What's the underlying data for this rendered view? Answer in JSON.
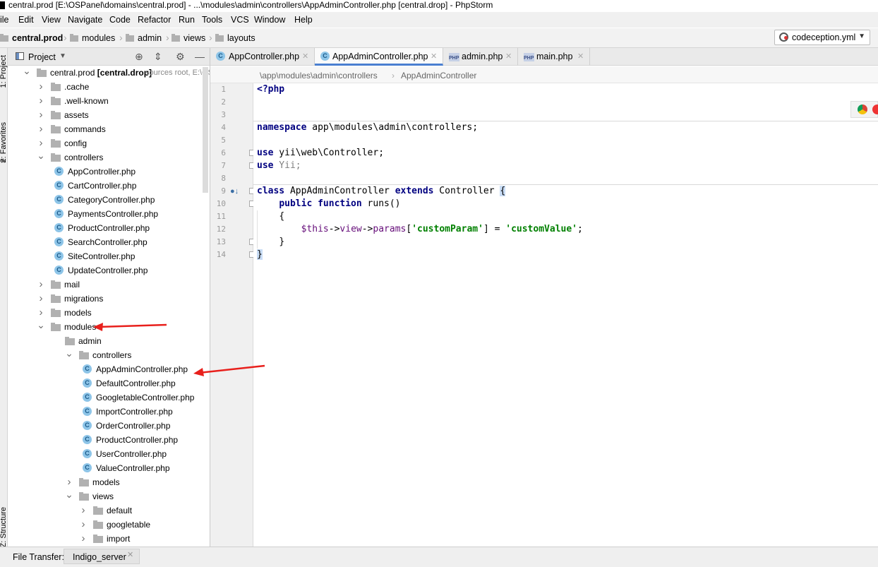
{
  "window": {
    "title": "central.prod [E:\\OSPanel\\domains\\central.prod] - ...\\modules\\admin\\controllers\\AppAdminController.php [central.drop] - PhpStorm"
  },
  "menu": [
    "ile",
    "Edit",
    "View",
    "Navigate",
    "Code",
    "Refactor",
    "Run",
    "Tools",
    "VCS",
    "Window",
    "Help"
  ],
  "navbar": {
    "crumbs": [
      "central.prod",
      "modules",
      "admin",
      "views",
      "layouts"
    ],
    "run_config": "codeception.yml"
  },
  "left_strip": {
    "project_tab": "1: Project",
    "favorites_tab": "2: Favorites",
    "structure_tab": "Z: Structure"
  },
  "project_panel": {
    "title": "Project",
    "tree": [
      {
        "label": "central.prod [central.drop]",
        "hint": "sources root,  E:\\OS",
        "type": "folder",
        "depth": 0,
        "state": "open"
      },
      {
        "label": ".cache",
        "type": "folder",
        "depth": 1,
        "state": "closed"
      },
      {
        "label": ".well-known",
        "type": "folder",
        "depth": 1,
        "state": "closed"
      },
      {
        "label": "assets",
        "type": "folder",
        "depth": 1,
        "state": "closed"
      },
      {
        "label": "commands",
        "type": "folder",
        "depth": 1,
        "state": "closed"
      },
      {
        "label": "config",
        "type": "folder",
        "depth": 1,
        "state": "closed"
      },
      {
        "label": "controllers",
        "type": "folder",
        "depth": 1,
        "state": "open"
      },
      {
        "label": "AppController.php",
        "type": "class",
        "depth": 2
      },
      {
        "label": "CartController.php",
        "type": "class",
        "depth": 2
      },
      {
        "label": "CategoryController.php",
        "type": "class",
        "depth": 2
      },
      {
        "label": "PaymentsController.php",
        "type": "class",
        "depth": 2
      },
      {
        "label": "ProductController.php",
        "type": "class",
        "depth": 2
      },
      {
        "label": "SearchController.php",
        "type": "class",
        "depth": 2
      },
      {
        "label": "SiteController.php",
        "type": "class",
        "depth": 2
      },
      {
        "label": "UpdateController.php",
        "type": "class",
        "depth": 2
      },
      {
        "label": "mail",
        "type": "folder",
        "depth": 1,
        "state": "closed"
      },
      {
        "label": "migrations",
        "type": "folder",
        "depth": 1,
        "state": "closed"
      },
      {
        "label": "models",
        "type": "folder",
        "depth": 1,
        "state": "closed"
      },
      {
        "label": "modules",
        "type": "folder",
        "depth": 1,
        "state": "open"
      },
      {
        "label": "admin",
        "type": "folder",
        "depth": 2,
        "state": "open-noarrow"
      },
      {
        "label": "controllers",
        "type": "folder",
        "depth": 3,
        "state": "open"
      },
      {
        "label": "AppAdminController.php",
        "type": "class",
        "depth": 4
      },
      {
        "label": "DefaultController.php",
        "type": "class",
        "depth": 4
      },
      {
        "label": "GoogletableController.php",
        "type": "class",
        "depth": 4
      },
      {
        "label": "ImportController.php",
        "type": "class",
        "depth": 4
      },
      {
        "label": "OrderController.php",
        "type": "class",
        "depth": 4
      },
      {
        "label": "ProductController.php",
        "type": "class",
        "depth": 4
      },
      {
        "label": "UserController.php",
        "type": "class",
        "depth": 4
      },
      {
        "label": "ValueController.php",
        "type": "class",
        "depth": 4
      },
      {
        "label": "models",
        "type": "folder",
        "depth": 3,
        "state": "closed"
      },
      {
        "label": "views",
        "type": "folder",
        "depth": 3,
        "state": "open"
      },
      {
        "label": "default",
        "type": "folder",
        "depth": 4,
        "state": "closed"
      },
      {
        "label": "googletable",
        "type": "folder",
        "depth": 4,
        "state": "closed"
      },
      {
        "label": "import",
        "type": "folder",
        "depth": 4,
        "state": "closed"
      }
    ]
  },
  "editor": {
    "tabs": [
      {
        "label": "AppController.php",
        "icon": "class",
        "active": false
      },
      {
        "label": "AppAdminController.php",
        "icon": "class",
        "active": true
      },
      {
        "label": "admin.php",
        "icon": "php",
        "active": false
      },
      {
        "label": "main.php",
        "icon": "php",
        "active": false
      }
    ],
    "breadcrumb": [
      "\\app\\modules\\admin\\controllers",
      "AppAdminController"
    ],
    "line_numbers": [
      "1",
      "2",
      "3",
      "4",
      "5",
      "6",
      "7",
      "8",
      "9",
      "10",
      "11",
      "12",
      "13",
      "14"
    ],
    "code": {
      "l1": "<?php",
      "l4_kw": "namespace",
      "l4_rest": " app\\modules\\admin\\controllers;",
      "l6_kw": "use",
      "l6_rest": " yii\\web\\Controller;",
      "l7_kw": "use",
      "l7_rest": " Yii;",
      "l9_kw1": "class",
      "l9_name": " AppAdminController ",
      "l9_kw2": "extends",
      "l9_rest": " Controller ",
      "l9_brace": "{",
      "l10_kw": "public function",
      "l10_rest": " runs()",
      "l11": "{",
      "l12_var": "$this",
      "l12_a1": "->",
      "l12_p1": "view",
      "l12_a2": "->",
      "l12_p2": "params",
      "l12_b1": "[",
      "l12_s1": "'customParam'",
      "l12_b2": "] = ",
      "l12_s2": "'customValue'",
      "l12_end": ";",
      "l13": "}",
      "l14": "}"
    }
  },
  "bottom_bar": {
    "label": "File Transfer:",
    "tab": "Indigo_server"
  },
  "colors": {
    "annotation_arrow": "#e8201c",
    "active_tab_underline": "#4a7fd0",
    "keyword": "#000080",
    "string": "#008000"
  }
}
